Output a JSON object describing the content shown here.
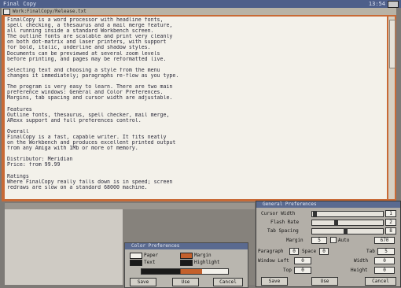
{
  "screen": {
    "title": "Final Copy",
    "clock": "13:54"
  },
  "editor": {
    "title": "Work:FinalCopy/Release.txt",
    "lines": [
      "FinalCopy is a word processor with headline fonts,",
      "spell checking, a thesaurus and a mail merge feature,",
      "all running inside a standard Workbench screen.",
      "The outline fonts are scalable and print very cleanly",
      "on both dot-matrix and laser printers, with support",
      "for bold, italic, underline and shadow styles.",
      "Documents can be previewed at several zoom levels",
      "before printing, and pages may be reformatted live.",
      "",
      "Selecting text and choosing a style from the menu",
      "changes it immediately; paragraphs re-flow as you type.",
      "",
      "The program is very easy to learn. There are two main",
      "preference windows: General and Color Preferences.",
      "Margins, tab spacing and cursor width are adjustable.",
      "",
      "Features",
      "Outline fonts, thesaurus, spell checker, mail merge,",
      "ARexx support and full preferences control.",
      "",
      "Overall",
      "FinalCopy is a fast, capable writer. It fits neatly",
      "on the Workbench and produces excellent printed output",
      "from any Amiga with 1Mb or more of memory.",
      "",
      "Distributor: Meridian",
      "Price: from 99.99",
      "",
      "Ratings",
      "Where FinalCopy really falls down is in speed; screen",
      "redraws are slow on a standard 68000 machine."
    ]
  },
  "color_prefs": {
    "title": "Color Preferences",
    "labels": {
      "paper": "Paper",
      "text": "Text",
      "margin": "Margin",
      "highlight": "Highlight"
    },
    "buttons": {
      "save": "Save",
      "use": "Use",
      "cancel": "Cancel"
    },
    "colors": {
      "paper": "#f2f0ea",
      "text": "#1a1a1a",
      "margin": "#c4602c",
      "highlight": "#1a1a1a"
    }
  },
  "general_prefs": {
    "title": "General Preferences",
    "labels": {
      "cursor_width": "Cursor Width",
      "flash_rate": "Flash Rate",
      "tab_spacing": "Tab Spacing",
      "margin": "Margin",
      "auto": "Auto",
      "paragraph": "Paragraph",
      "spacing": "Space",
      "tab": "Tab",
      "window_left": "Window Left",
      "window_top": "Top",
      "width": "Width",
      "height": "Height"
    },
    "values": {
      "cursor_width": "1",
      "flash_rate": "2",
      "tab_spacing": "8",
      "margin": "5",
      "auto": "670",
      "paragraph": "0",
      "spacing": "0",
      "tab": "5",
      "left": "0",
      "top": "0",
      "width": "0",
      "height": "0"
    },
    "buttons": {
      "save": "Save",
      "use": "Use",
      "cancel": "Cancel"
    }
  }
}
